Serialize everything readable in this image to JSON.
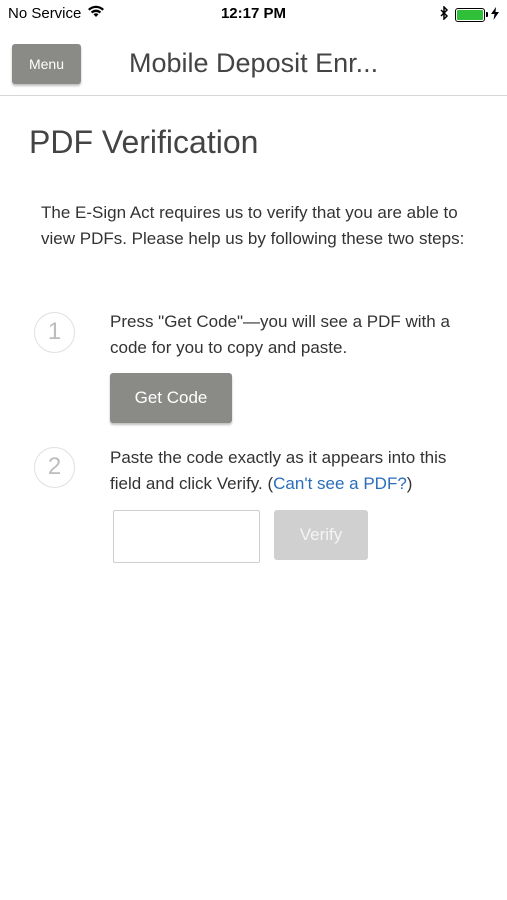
{
  "status_bar": {
    "carrier": "No Service",
    "time": "12:17 PM",
    "icons": [
      "wifi-icon",
      "bluetooth-icon",
      "battery-icon",
      "charging-icon"
    ]
  },
  "navbar": {
    "menu_label": "Menu",
    "title": "Mobile Deposit Enr..."
  },
  "page": {
    "title": "PDF Verification",
    "intro": "The E-Sign Act requires us to verify that you are able to view PDFs. Please help us by following these two steps:"
  },
  "steps": [
    {
      "number": "1",
      "text": "Press \"Get Code\"—you will see a PDF with a code for you to copy and paste.",
      "button_label": "Get Code"
    },
    {
      "number": "2",
      "text_before_link": "Paste the code exactly as it appears into this field and click Verify. (",
      "link_text": "Can't see a PDF?",
      "text_after_link": ")",
      "input_value": "",
      "input_placeholder": "",
      "button_label": "Verify"
    }
  ],
  "colors": {
    "button_gray": "#8a8a86",
    "button_disabled": "#d0d0d0",
    "link_blue": "#2a6ebb",
    "battery_green": "#2fbf39"
  }
}
